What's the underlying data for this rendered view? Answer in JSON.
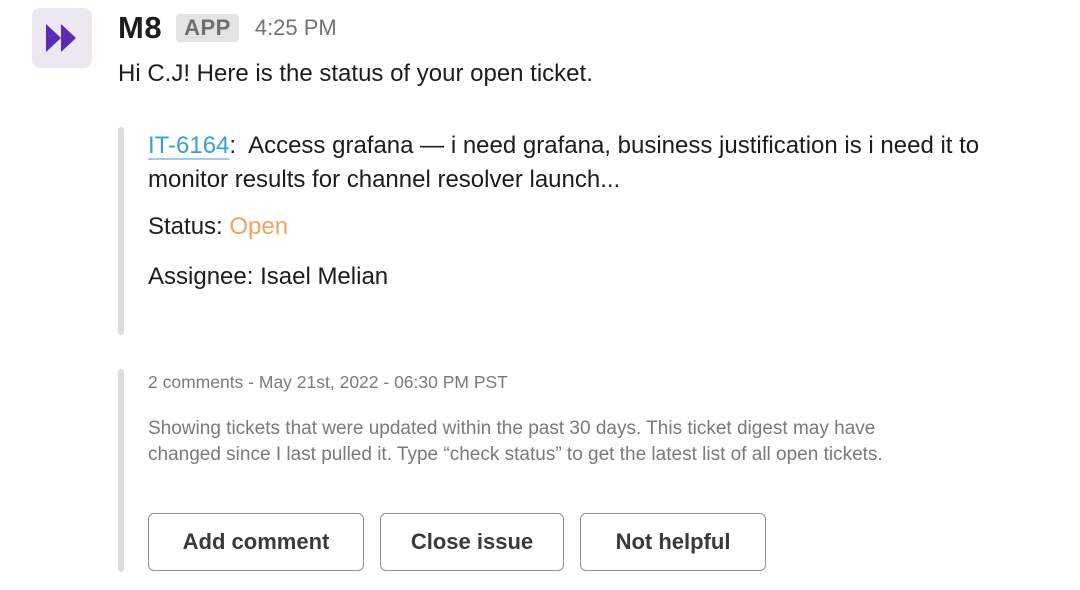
{
  "message": {
    "sender": "M8",
    "app_badge": "APP",
    "time": "4:25 PM",
    "avatar_icon": "fast-forward-logo-icon",
    "brand_color": "#5b2bb5",
    "greeting": "Hi C.J!  Here is the status of your open ticket."
  },
  "ticket": {
    "id": "IT-6164",
    "separator": ":",
    "summary": "Access grafana — i need grafana, business justification is i need it to monitor results for channel resolver launch...",
    "status_label": "Status: ",
    "status_value": "Open",
    "status_color": "#f2a35a",
    "assignee_label": "Assignee: ",
    "assignee_value": "Isael Melian"
  },
  "footer": {
    "meta": "2 comments - May 21st, 2022 - 06:30 PM PST",
    "note": "Showing tickets that were updated within the past 30 days. This ticket digest may have changed since I last pulled it. Type “check status” to get the latest list of all open tickets."
  },
  "actions": {
    "add_comment": "Add comment",
    "close_issue": "Close issue",
    "not_helpful": "Not helpful"
  }
}
